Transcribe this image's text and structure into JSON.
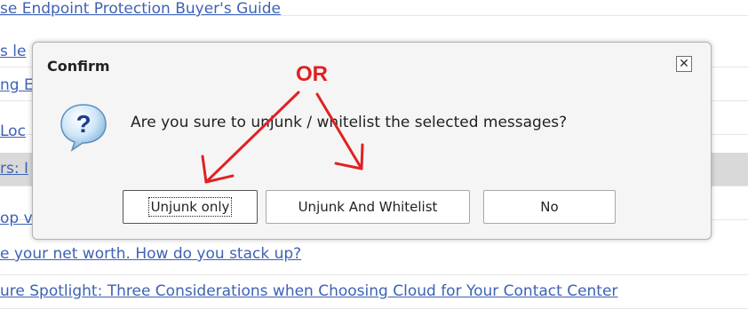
{
  "background_list": {
    "rows": [
      "se Endpoint Protection Buyer's Guide",
      "s le",
      "ng E",
      "Loc",
      "rs: I",
      "op v",
      "e your net worth. How do you stack up?",
      "ure Spotlight: Three Considerations when Choosing Cloud for Your Contact Center"
    ]
  },
  "dialog": {
    "title": "Confirm",
    "close_symbol": "✕",
    "message": "Are you sure to unjunk / whitelist the selected messages?",
    "icon": "question-icon",
    "buttons": {
      "unjunk_only": "Unjunk only",
      "unjunk_whitelist": "Unjunk And Whitelist",
      "no": "No"
    }
  },
  "annotation": {
    "label": "OR",
    "color": "#e02121"
  }
}
